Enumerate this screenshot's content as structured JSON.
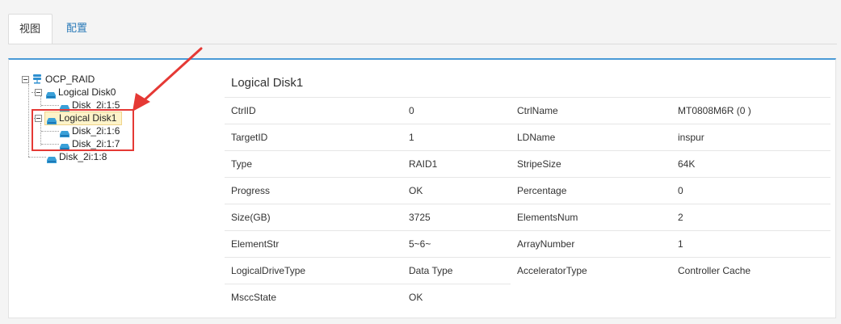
{
  "tabs": [
    {
      "label": "视图",
      "active": true
    },
    {
      "label": "配置",
      "active": false
    }
  ],
  "tree": {
    "root": {
      "label": "OCP_RAID",
      "icon": "server-icon"
    },
    "items": [
      {
        "label": "Logical Disk0",
        "icon": "disk-icon",
        "level": 1,
        "expanded": true
      },
      {
        "label": "Disk_2i:1:5",
        "icon": "disk-icon",
        "level": 2
      },
      {
        "label": "Logical Disk1",
        "icon": "disk-icon",
        "level": 1,
        "expanded": true,
        "selected": true
      },
      {
        "label": "Disk_2i:1:6",
        "icon": "disk-icon",
        "level": 2
      },
      {
        "label": "Disk_2i:1:7",
        "icon": "disk-icon",
        "level": 2
      },
      {
        "label": "Disk_2i:1:8",
        "icon": "disk-icon",
        "level": 1
      }
    ]
  },
  "details": {
    "title": "Logical Disk1",
    "rows": [
      {
        "k1": "CtrlID",
        "v1": "0",
        "k2": "CtrlName",
        "v2": "MT0808M6R (0 )"
      },
      {
        "k1": "TargetID",
        "v1": "1",
        "k2": "LDName",
        "v2": "inspur"
      },
      {
        "k1": "Type",
        "v1": "RAID1",
        "k2": "StripeSize",
        "v2": "64K"
      },
      {
        "k1": "Progress",
        "v1": "OK",
        "k2": "Percentage",
        "v2": "0"
      },
      {
        "k1": "Size(GB)",
        "v1": "3725",
        "k2": "ElementsNum",
        "v2": "2"
      },
      {
        "k1": "ElementStr",
        "v1": "5~6~",
        "k2": "ArrayNumber",
        "v2": "1"
      },
      {
        "k1": "LogicalDriveType",
        "v1": "Data Type",
        "k2": "AcceleratorType",
        "v2": "Controller Cache"
      },
      {
        "k1": "MsccState",
        "v1": "OK",
        "k2": "",
        "v2": ""
      }
    ]
  },
  "colors": {
    "accent": "#4a9ad6",
    "link": "#2a7ab8",
    "selection": "#fdf3c9",
    "annotation": "#e53935",
    "disk_icon": "#3aa0d8"
  }
}
